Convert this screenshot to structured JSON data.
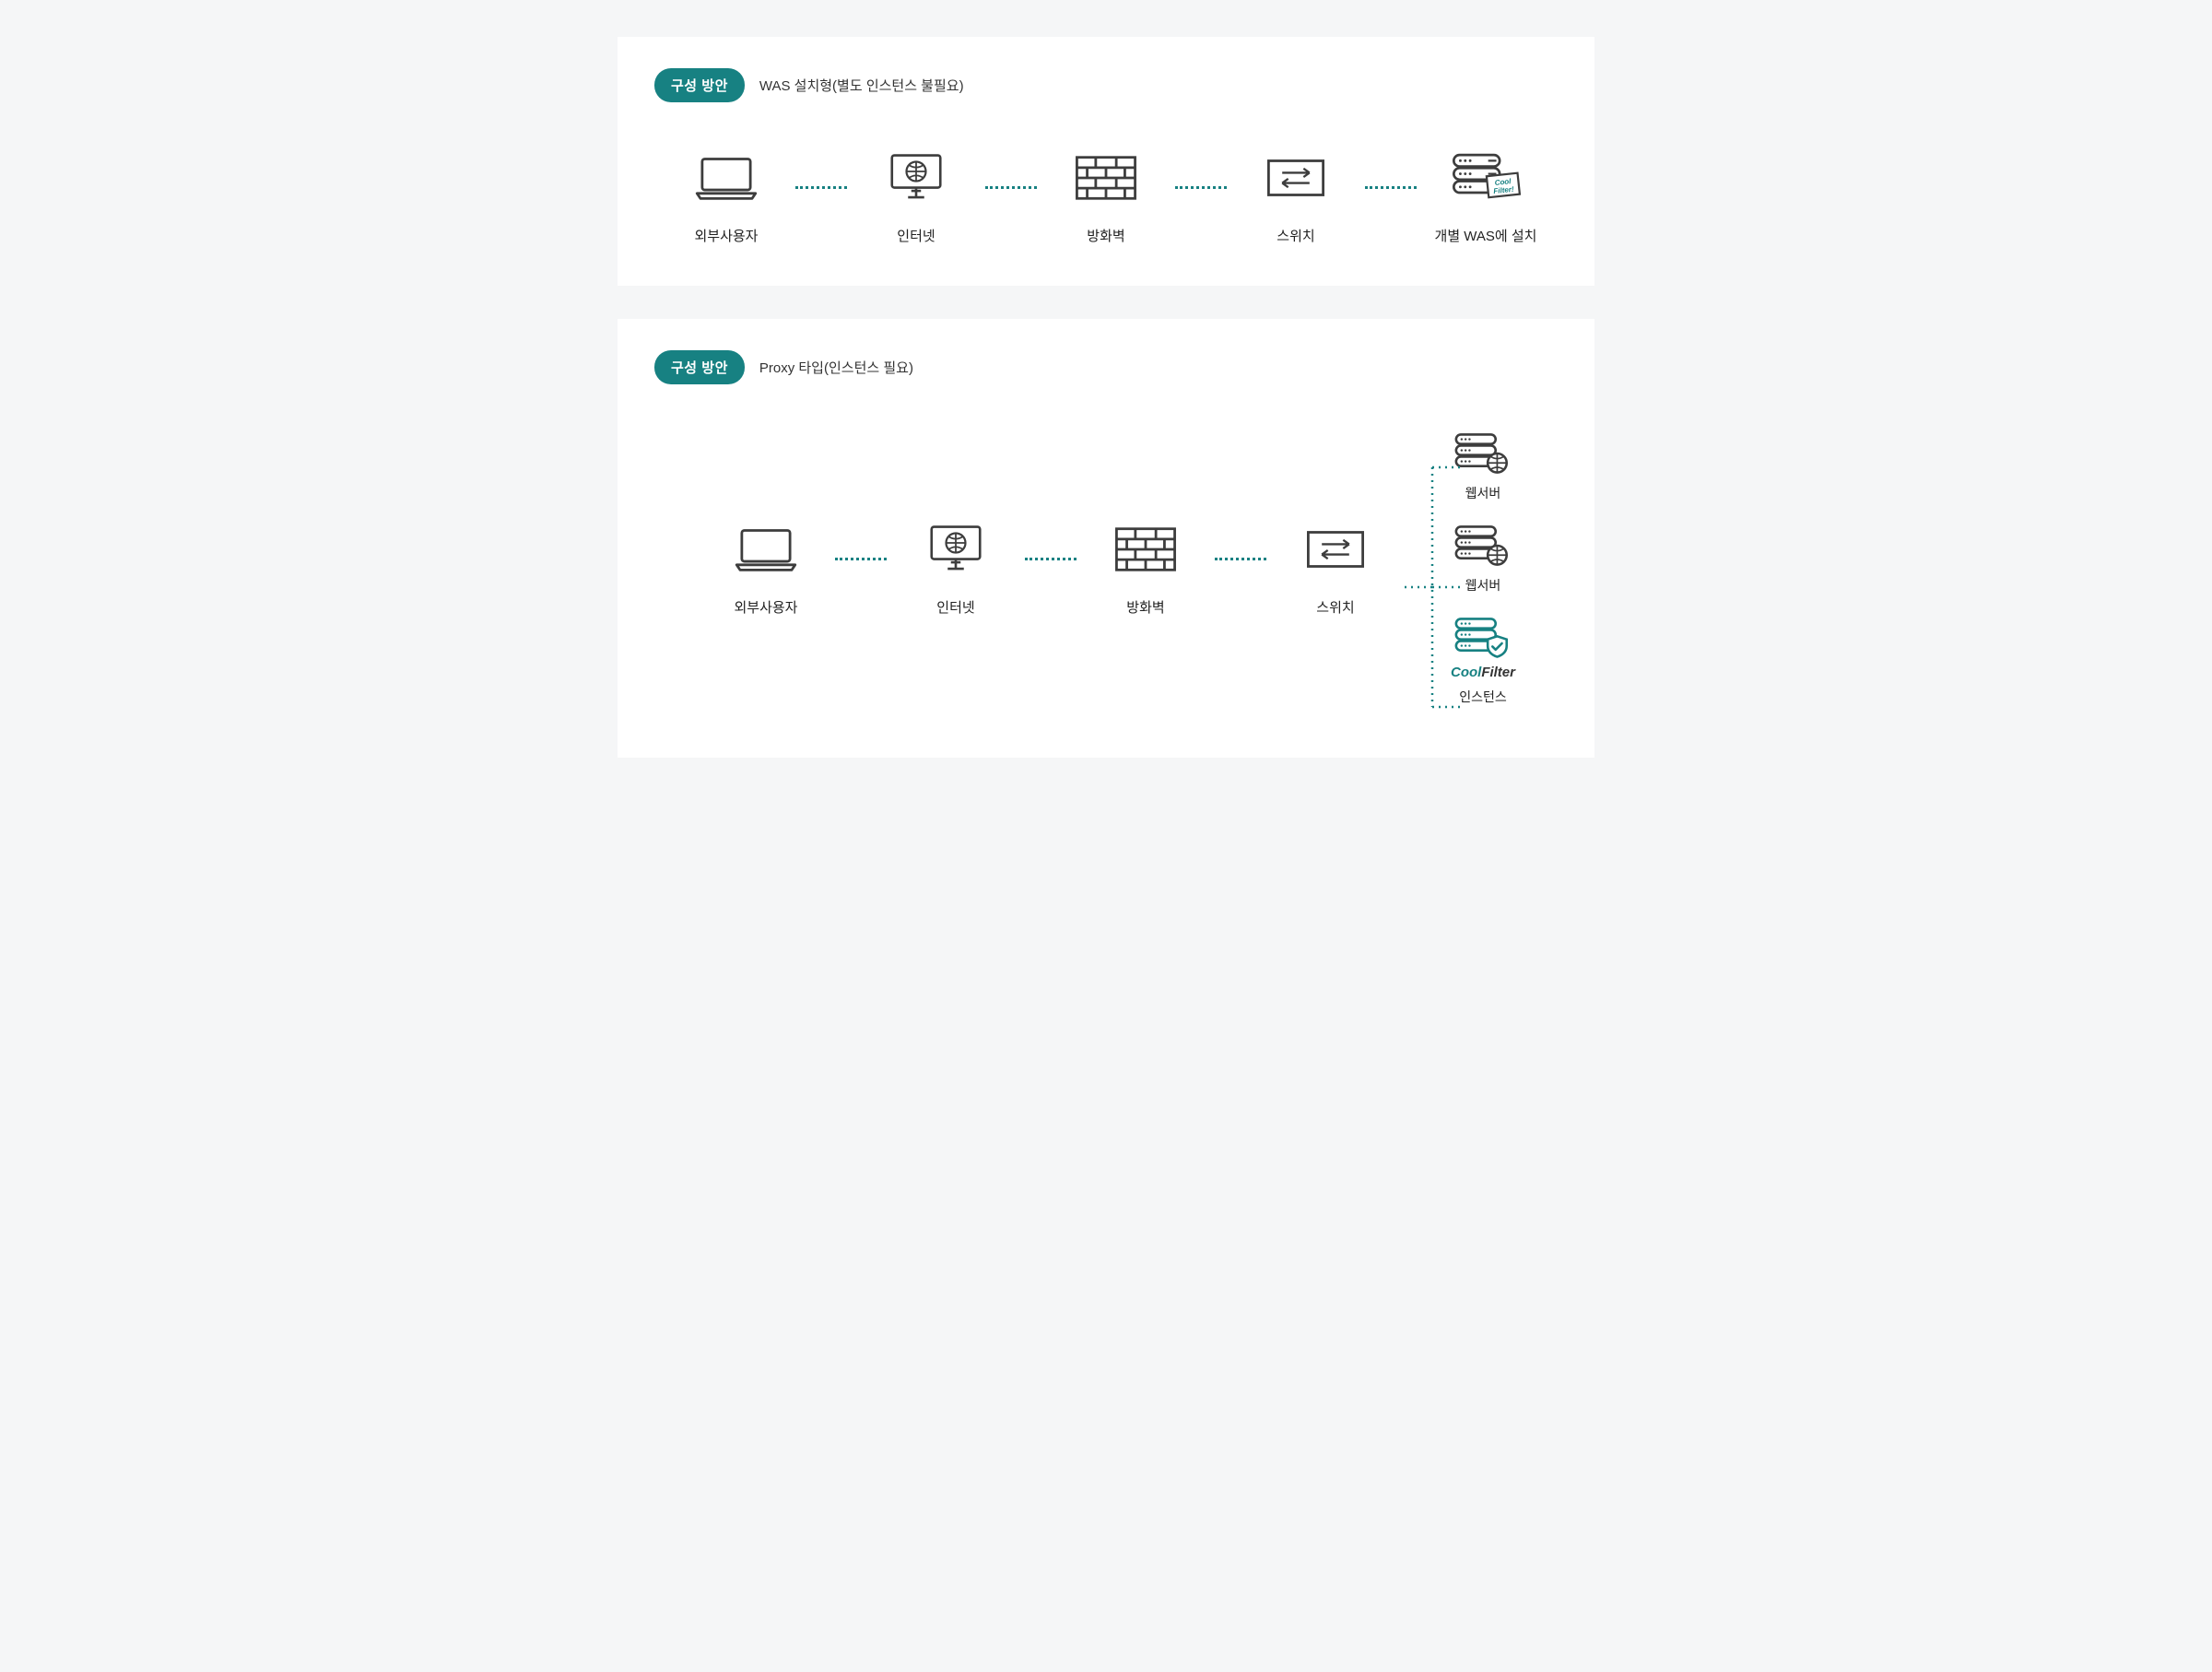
{
  "colors": {
    "accent": "#178182",
    "icon": "#3d3d3d",
    "page_bg": "#f5f6f7",
    "panel_bg": "#ffffff"
  },
  "panel1": {
    "badge": "구성 방안",
    "subtitle": "WAS 설치형(별도 인스턴스 불필요)",
    "nodes": {
      "client": {
        "label": "외부사용자",
        "icon": "laptop-icon"
      },
      "internet": {
        "label": "인터넷",
        "icon": "globe-monitor-icon"
      },
      "firewall": {
        "label": "방화벽",
        "icon": "firewall-icon"
      },
      "switch": {
        "label": "스위치",
        "icon": "switch-icon"
      },
      "was": {
        "label": "개별 WAS에 설치",
        "icon": "server-coolfilter-icon",
        "sticker": "Cool Filter!"
      }
    }
  },
  "panel2": {
    "badge": "구성 방안",
    "subtitle": "Proxy 타입(인스턴스 필요)",
    "nodes": {
      "client": {
        "label": "외부사용자",
        "icon": "laptop-icon"
      },
      "internet": {
        "label": "인터넷",
        "icon": "globe-monitor-icon"
      },
      "firewall": {
        "label": "방화벽",
        "icon": "firewall-icon"
      },
      "switch": {
        "label": "스위치",
        "icon": "switch-icon"
      }
    },
    "branch": {
      "web1": {
        "label": "웹서버",
        "icon": "server-globe-icon"
      },
      "web2": {
        "label": "웹서버",
        "icon": "server-globe-icon"
      },
      "instance": {
        "logo_a": "Cool",
        "logo_b": "Filter",
        "label": "인스턴스",
        "icon": "server-shield-icon"
      }
    }
  }
}
